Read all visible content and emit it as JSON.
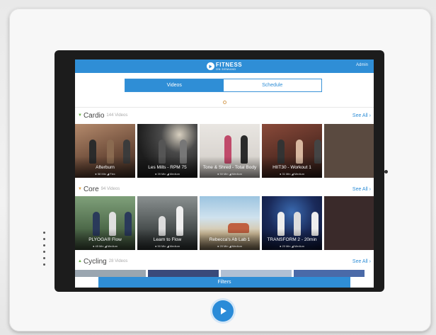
{
  "app": {
    "logo_top": "FITNESS",
    "logo_bottom": "ON DEMAND",
    "admin_label": "Admin"
  },
  "tabs": [
    {
      "label": "Videos",
      "active": true
    },
    {
      "label": "Schedule",
      "active": false
    }
  ],
  "search": {
    "icon": "search-icon"
  },
  "rows": [
    {
      "name": "Cardio",
      "count": "144 Videos",
      "see_all": "See All ›",
      "tiles": [
        {
          "title": "Afterburn",
          "meta": "● 58 Min  ◢ Flex"
        },
        {
          "title": "Les Mills - RPM 75",
          "meta": "● 39 Min  ◢ Medium"
        },
        {
          "title": "Tone & Shred - Total Body",
          "meta": "● 50 Min  ◢ Medium"
        },
        {
          "title": "HIIT30 - Workout 1",
          "meta": "● 31 Min  ◢ Medium"
        }
      ]
    },
    {
      "name": "Core",
      "count": "94 Videos",
      "see_all": "See All ›",
      "tiles": [
        {
          "title": "PLYOGA® Flow",
          "meta": "● 45 Min  ◢ Medium"
        },
        {
          "title": "Learn to Flow",
          "meta": "● 50 Min  ◢ Medium"
        },
        {
          "title": "Rebecca's Ab Lab 1",
          "meta": "● 20 Min  ◢ Medium"
        },
        {
          "title": "TRANSFORM 2 - 20min",
          "meta": "● 20 Min  ◢ Medium"
        }
      ]
    },
    {
      "name": "Cycling",
      "count": "28 Videos",
      "see_all": "See All ›",
      "tiles": []
    }
  ],
  "filters_label": "Filters",
  "colors": {
    "accent": "#2f8ed6",
    "category_arrow": "#6bb24a"
  }
}
